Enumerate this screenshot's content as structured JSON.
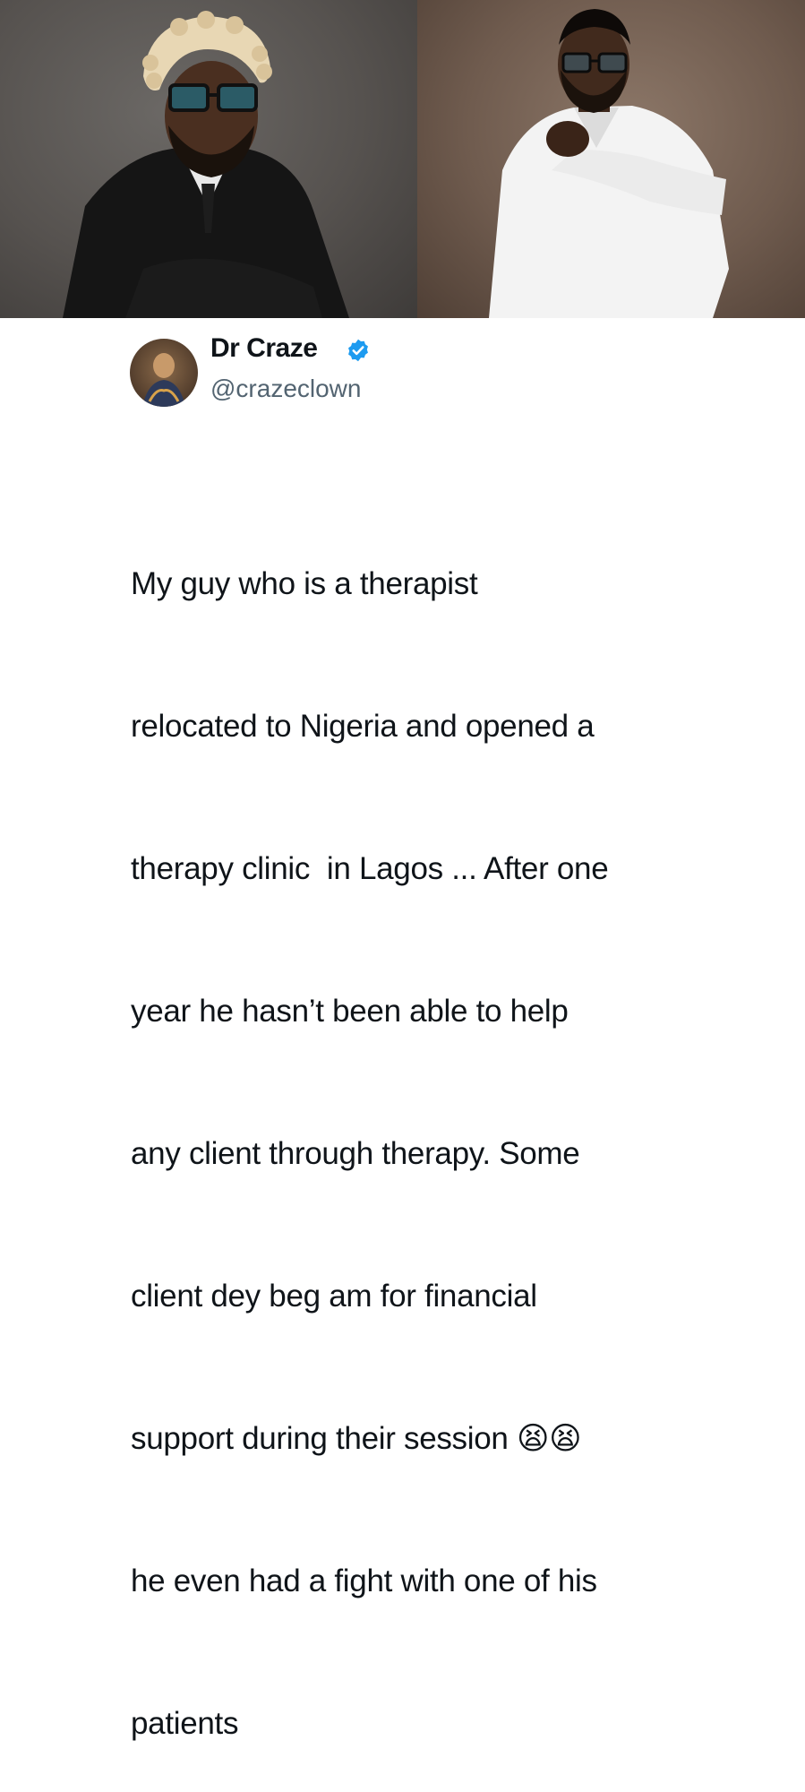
{
  "tweet": {
    "display_name": "Dr Craze",
    "handle": "@crazeclown",
    "verified_icon": "verified-badge-icon",
    "text_lines": [
      "My guy who is a therapist",
      "relocated to Nigeria and opened a",
      "therapy clinic  in Lagos ... After one",
      "year he hasn’t been able to help",
      "any client through therapy. Some",
      "client dey beg am for financial",
      "support during their session 😫😫",
      "he even had a fight with one of his",
      "patients"
    ]
  },
  "colors": {
    "verified_blue": "#1d9bf0",
    "handle_gray": "#536471",
    "text": "#0f1419"
  }
}
